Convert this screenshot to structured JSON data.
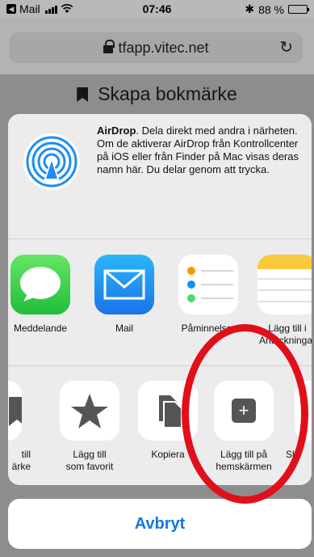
{
  "status_bar": {
    "back_label": "Mail",
    "time": "07:46",
    "bluetooth": "✱",
    "battery_text": "88 %",
    "battery_level": 0.88
  },
  "url_bar": {
    "url": "tfapp.vitec.net",
    "reload_glyph": "↻"
  },
  "page": {
    "heading": "Skapa bokmärke"
  },
  "airdrop": {
    "title": "AirDrop",
    "description": ". Dela direkt med andra i närheten. Om de aktiverar AirDrop från Kontrollcenter på iOS eller från Finder på Mac visas deras namn här. Du delar genom att trycka."
  },
  "apps": [
    {
      "label": "Meddelande",
      "icon": "messages-icon"
    },
    {
      "label": "Mail",
      "icon": "mail-icon"
    },
    {
      "label": "Påminnelser",
      "icon": "reminders-icon"
    },
    {
      "label": "Lägg till i\nAnteckningar",
      "icon": "notes-icon"
    }
  ],
  "actions": [
    {
      "label": "till\närke",
      "icon": "bookmark-icon"
    },
    {
      "label": "Lägg till\nsom favorit",
      "icon": "star-icon"
    },
    {
      "label": "Kopiera",
      "icon": "copy-icon"
    },
    {
      "label": "Lägg till på\nhemskärmen",
      "icon": "add-to-home-icon",
      "add_glyph": "+"
    },
    {
      "label": "Sl",
      "icon": "more-icon"
    }
  ],
  "cancel": {
    "label": "Avbryt"
  },
  "colors": {
    "accent": "#1475e8",
    "highlight": "#e10f1a"
  }
}
